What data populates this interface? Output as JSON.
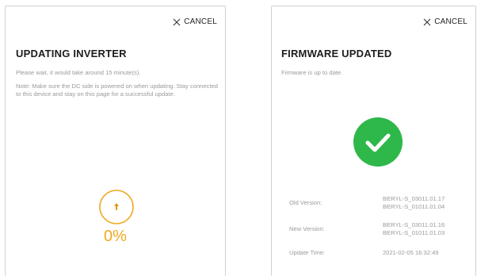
{
  "left_screen": {
    "cancel_label": "CANCEL",
    "title": "UPDATING INVERTER",
    "wait_text": "Please wait,  it would take around  15  minute(s).",
    "note_text": "Note: Make sure the DC side is powered on when updating. Stay connected to this device and stay on this page for a successful update.",
    "progress_percent": 0,
    "progress_label": "0%",
    "accent_color": "#f0a920"
  },
  "right_screen": {
    "cancel_label": "CANCEL",
    "title": "FIRMWARE UPDATED",
    "subtitle": "Firmware is up to date.",
    "success_color": "#2fb84a",
    "info": {
      "old_version_label": "Old Version:",
      "old_version_line1": "BERYL-S_03011.01.17",
      "old_version_line2": "BERYL-S_01011.01.04",
      "new_version_label": "New Version:",
      "new_version_line1": "BERYL-S_03011.01.16",
      "new_version_line2": "BERYL-S_01011.01.03",
      "update_time_label": "Update Time:",
      "update_time_value": "2021-02-05 16:32:49"
    }
  }
}
